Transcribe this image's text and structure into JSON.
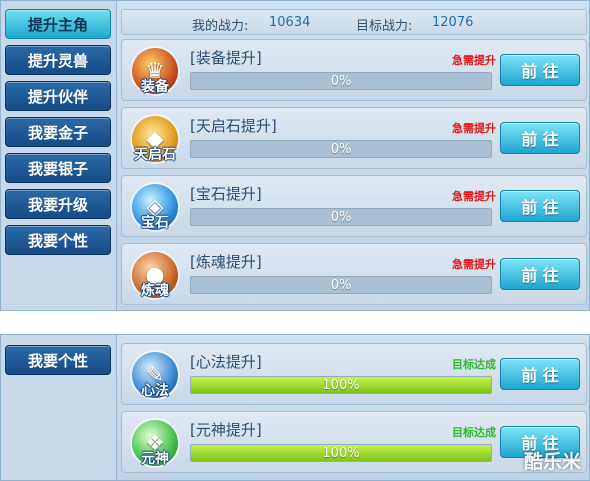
{
  "sidebar": {
    "items": [
      {
        "label": "提升主角",
        "active": true
      },
      {
        "label": "提升灵兽"
      },
      {
        "label": "提升伙伴"
      },
      {
        "label": "我要金子"
      },
      {
        "label": "我要银子"
      },
      {
        "label": "我要升级"
      },
      {
        "label": "我要个性"
      }
    ],
    "bottom_item": {
      "label": "我要个性"
    }
  },
  "stats": {
    "my_power_label": "我的战力:",
    "my_power_value": "10634",
    "target_power_label": "目标战力:",
    "target_power_value": "12076"
  },
  "cards": [
    {
      "icon": "equipment-icon",
      "badge": "装备",
      "title": "[装备提升]",
      "status": "急需提升",
      "progress": 0,
      "progress_text": "0%",
      "button": "前 往"
    },
    {
      "icon": "sky-stone-icon",
      "badge": "天启石",
      "title": "[天启石提升]",
      "status": "急需提升",
      "progress": 0,
      "progress_text": "0%",
      "button": "前 往"
    },
    {
      "icon": "gem-icon",
      "badge": "宝石",
      "title": "[宝石提升]",
      "status": "急需提升",
      "progress": 0,
      "progress_text": "0%",
      "button": "前 往"
    },
    {
      "icon": "soul-refine-icon",
      "badge": "炼魂",
      "title": "[炼魂提升]",
      "status": "急需提升",
      "progress": 0,
      "progress_text": "0%",
      "button": "前 往"
    }
  ],
  "cards_bottom": [
    {
      "icon": "scroll-icon",
      "badge": "心法",
      "title": "[心法提升]",
      "status": "目标达成",
      "progress": 100,
      "progress_text": "100%",
      "button": "前 往"
    },
    {
      "icon": "spirit-icon",
      "badge": "元神",
      "title": "[元神提升]",
      "status": "目标达成",
      "progress": 100,
      "progress_text": "100%",
      "button": "前 往"
    }
  ],
  "colors": {
    "urgent": "#e01818",
    "achieved": "#2db82d",
    "accent": "#20a7cd"
  },
  "watermark": "酷乐米"
}
